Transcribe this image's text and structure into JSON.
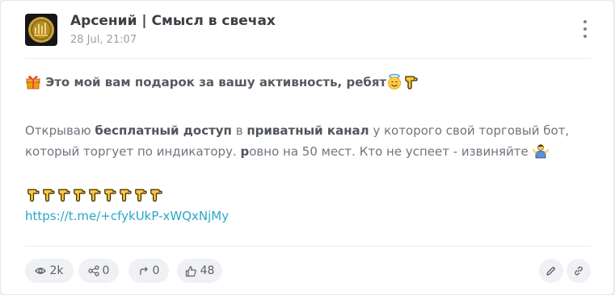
{
  "post": {
    "author": "Арсений | Смысл в свечах",
    "date": "28 Jul, 21:07",
    "headline_text": "Это мой вам подарок за вашу активность, ребят",
    "p2_t1": "Открываю ",
    "p2_b1": "бесплатный доступ",
    "p2_t2": " в ",
    "p2_b2": "приватный канал",
    "p2_t3": " у которого свой торговый бот,",
    "p2_t4": "который торгует по индикатору. ",
    "p2_b3": "р",
    "p2_t5": "овно на 50 мест. Кто не успеет - извиняйте",
    "link": "https://t.me/+cfykUkP-xWQxNjMy"
  },
  "stats": {
    "views": "2k",
    "shares": "0",
    "reposts": "0",
    "likes": "48"
  },
  "icons": {
    "gift": "gift-emoji",
    "halo": "smiling-face-with-halo-emoji",
    "hand": "backhand-index-pointing-down-emoji",
    "shrug": "person-shrugging-emoji",
    "views": "eye-icon",
    "share": "share-icon",
    "repost": "repost-icon",
    "like": "thumbs-up-icon",
    "edit": "pencil-icon",
    "copy_link": "link-icon",
    "menu": "more-vertical-icon"
  },
  "colors": {
    "link": "#2aa6c9",
    "card": "#ffffff",
    "pill": "#f0f1f4"
  }
}
